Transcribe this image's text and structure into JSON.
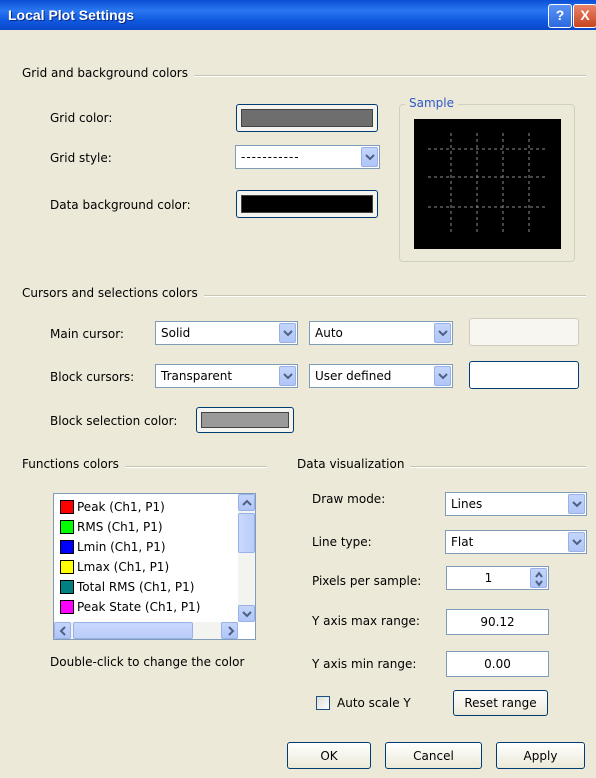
{
  "window": {
    "title": "Local Plot Settings",
    "help_glyph": "?",
    "close_glyph": "X"
  },
  "grid_group": {
    "title": "Grid and background colors",
    "grid_color_label": "Grid color:",
    "grid_color": "#6e6e6e",
    "grid_style_label": "Grid style:",
    "grid_style_value": "-----------",
    "data_bg_label": "Data background color:",
    "data_bg_color": "#000000",
    "sample_title": "Sample"
  },
  "cursor_group": {
    "title": "Cursors and selections colors",
    "main_cursor_label": "Main cursor:",
    "main_cursor_style": "Solid",
    "main_cursor_color_mode": "Auto",
    "block_cursors_label": "Block cursors:",
    "block_cursors_style": "Transparent",
    "block_cursors_color_mode": "User defined",
    "block_selection_label": "Block selection color:",
    "block_selection_color": "#9a9a9a"
  },
  "functions_group": {
    "title": "Functions colors",
    "items": [
      {
        "label": "Peak (Ch1, P1)",
        "color": "#ff0000"
      },
      {
        "label": "RMS (Ch1, P1)",
        "color": "#00ff00"
      },
      {
        "label": "Lmin (Ch1, P1)",
        "color": "#0000ff"
      },
      {
        "label": "Lmax (Ch1, P1)",
        "color": "#ffff00"
      },
      {
        "label": "Total RMS (Ch1, P1)",
        "color": "#008080"
      },
      {
        "label": "Peak State (Ch1, P1)",
        "color": "#ff00ff"
      }
    ],
    "hint": "Double-click to change the color"
  },
  "visualization_group": {
    "title": "Data visualization",
    "draw_mode_label": "Draw mode:",
    "draw_mode_value": "Lines",
    "line_type_label": "Line type:",
    "line_type_value": "Flat",
    "pixels_label": "Pixels per sample:",
    "pixels_value": "1",
    "ymax_label": "Y axis max range:",
    "ymax_value": "90.12",
    "ymin_label": "Y axis min range:",
    "ymin_value": "0.00",
    "auto_scale_label": "Auto scale Y",
    "auto_scale_checked": false,
    "reset_label": "Reset range"
  },
  "footer": {
    "ok": "OK",
    "cancel": "Cancel",
    "apply": "Apply"
  }
}
